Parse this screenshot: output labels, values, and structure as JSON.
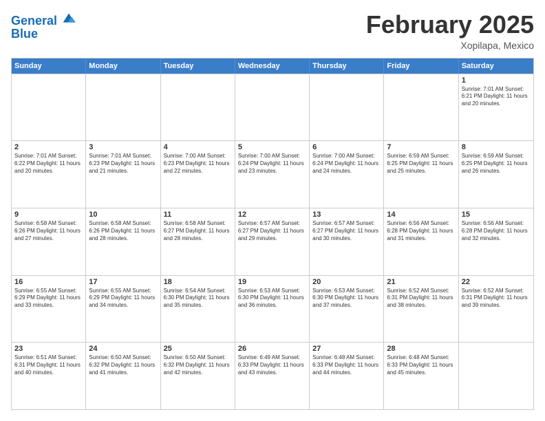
{
  "header": {
    "logo_line1": "General",
    "logo_line2": "Blue",
    "month_title": "February 2025",
    "subtitle": "Xopilapa, Mexico"
  },
  "weekdays": [
    "Sunday",
    "Monday",
    "Tuesday",
    "Wednesday",
    "Thursday",
    "Friday",
    "Saturday"
  ],
  "weeks": [
    [
      {
        "day": "",
        "info": ""
      },
      {
        "day": "",
        "info": ""
      },
      {
        "day": "",
        "info": ""
      },
      {
        "day": "",
        "info": ""
      },
      {
        "day": "",
        "info": ""
      },
      {
        "day": "",
        "info": ""
      },
      {
        "day": "1",
        "info": "Sunrise: 7:01 AM\nSunset: 6:21 PM\nDaylight: 11 hours\nand 20 minutes."
      }
    ],
    [
      {
        "day": "2",
        "info": "Sunrise: 7:01 AM\nSunset: 6:22 PM\nDaylight: 11 hours\nand 20 minutes."
      },
      {
        "day": "3",
        "info": "Sunrise: 7:01 AM\nSunset: 6:23 PM\nDaylight: 11 hours\nand 21 minutes."
      },
      {
        "day": "4",
        "info": "Sunrise: 7:00 AM\nSunset: 6:23 PM\nDaylight: 11 hours\nand 22 minutes."
      },
      {
        "day": "5",
        "info": "Sunrise: 7:00 AM\nSunset: 6:24 PM\nDaylight: 11 hours\nand 23 minutes."
      },
      {
        "day": "6",
        "info": "Sunrise: 7:00 AM\nSunset: 6:24 PM\nDaylight: 11 hours\nand 24 minutes."
      },
      {
        "day": "7",
        "info": "Sunrise: 6:59 AM\nSunset: 6:25 PM\nDaylight: 11 hours\nand 25 minutes."
      },
      {
        "day": "8",
        "info": "Sunrise: 6:59 AM\nSunset: 6:25 PM\nDaylight: 11 hours\nand 26 minutes."
      }
    ],
    [
      {
        "day": "9",
        "info": "Sunrise: 6:58 AM\nSunset: 6:26 PM\nDaylight: 11 hours\nand 27 minutes."
      },
      {
        "day": "10",
        "info": "Sunrise: 6:58 AM\nSunset: 6:26 PM\nDaylight: 11 hours\nand 28 minutes."
      },
      {
        "day": "11",
        "info": "Sunrise: 6:58 AM\nSunset: 6:27 PM\nDaylight: 11 hours\nand 28 minutes."
      },
      {
        "day": "12",
        "info": "Sunrise: 6:57 AM\nSunset: 6:27 PM\nDaylight: 11 hours\nand 29 minutes."
      },
      {
        "day": "13",
        "info": "Sunrise: 6:57 AM\nSunset: 6:27 PM\nDaylight: 11 hours\nand 30 minutes."
      },
      {
        "day": "14",
        "info": "Sunrise: 6:56 AM\nSunset: 6:28 PM\nDaylight: 11 hours\nand 31 minutes."
      },
      {
        "day": "15",
        "info": "Sunrise: 6:56 AM\nSunset: 6:28 PM\nDaylight: 11 hours\nand 32 minutes."
      }
    ],
    [
      {
        "day": "16",
        "info": "Sunrise: 6:55 AM\nSunset: 6:29 PM\nDaylight: 11 hours\nand 33 minutes."
      },
      {
        "day": "17",
        "info": "Sunrise: 6:55 AM\nSunset: 6:29 PM\nDaylight: 11 hours\nand 34 minutes."
      },
      {
        "day": "18",
        "info": "Sunrise: 6:54 AM\nSunset: 6:30 PM\nDaylight: 11 hours\nand 35 minutes."
      },
      {
        "day": "19",
        "info": "Sunrise: 6:53 AM\nSunset: 6:30 PM\nDaylight: 11 hours\nand 36 minutes."
      },
      {
        "day": "20",
        "info": "Sunrise: 6:53 AM\nSunset: 6:30 PM\nDaylight: 11 hours\nand 37 minutes."
      },
      {
        "day": "21",
        "info": "Sunrise: 6:52 AM\nSunset: 6:31 PM\nDaylight: 11 hours\nand 38 minutes."
      },
      {
        "day": "22",
        "info": "Sunrise: 6:52 AM\nSunset: 6:31 PM\nDaylight: 11 hours\nand 39 minutes."
      }
    ],
    [
      {
        "day": "23",
        "info": "Sunrise: 6:51 AM\nSunset: 6:31 PM\nDaylight: 11 hours\nand 40 minutes."
      },
      {
        "day": "24",
        "info": "Sunrise: 6:50 AM\nSunset: 6:32 PM\nDaylight: 11 hours\nand 41 minutes."
      },
      {
        "day": "25",
        "info": "Sunrise: 6:50 AM\nSunset: 6:32 PM\nDaylight: 11 hours\nand 42 minutes."
      },
      {
        "day": "26",
        "info": "Sunrise: 6:49 AM\nSunset: 6:33 PM\nDaylight: 11 hours\nand 43 minutes."
      },
      {
        "day": "27",
        "info": "Sunrise: 6:48 AM\nSunset: 6:33 PM\nDaylight: 11 hours\nand 44 minutes."
      },
      {
        "day": "28",
        "info": "Sunrise: 6:48 AM\nSunset: 6:33 PM\nDaylight: 11 hours\nand 45 minutes."
      },
      {
        "day": "",
        "info": ""
      }
    ]
  ]
}
